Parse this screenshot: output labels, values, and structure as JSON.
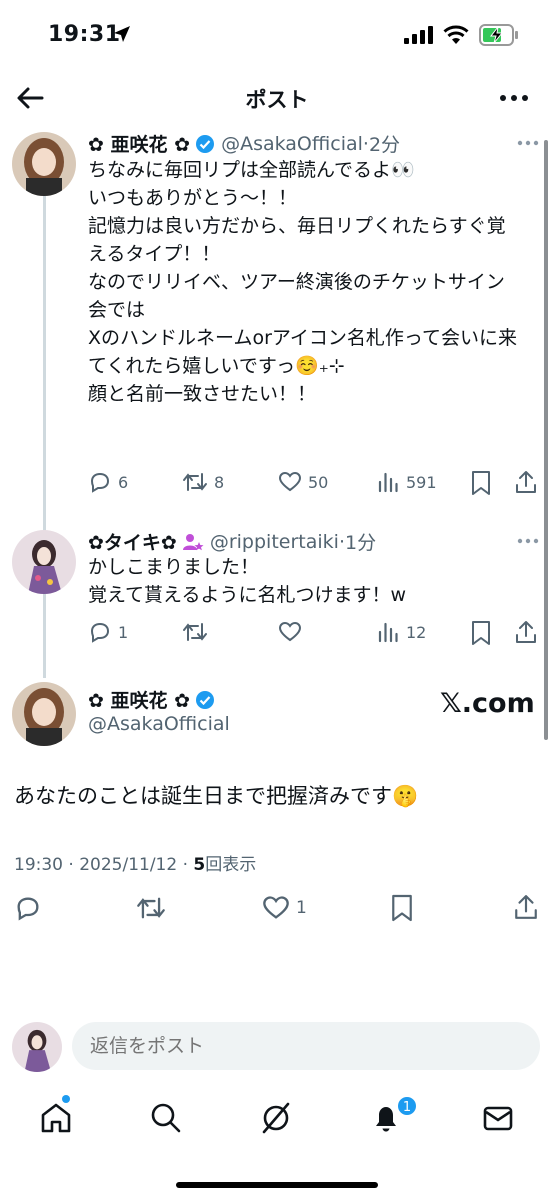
{
  "status_bar": {
    "time": "19:31"
  },
  "nav": {
    "title": "ポスト"
  },
  "thread": [
    {
      "name": "✿ 亜咲花 ✿",
      "handle": "@AsakaOfficial",
      "sep": "·",
      "time": "2分",
      "text_lines": [
        "ちなみに毎回リプは全部読んでるよ👀",
        "いつもありがとう〜！！",
        "",
        "記憶力は良い方だから、毎日リプくれたらすぐ覚",
        "えるタイプ！！",
        "",
        "なのでリリイベ、ツアー終演後のチケットサイン",
        "会では",
        "Xのハンドルネームorアイコン名札作って会いに来",
        "てくれたら嬉しいですっ☺️₊⊹",
        "顔と名前一致させたい！！"
      ],
      "replies": "6",
      "reposts": "8",
      "likes": "50",
      "views": "591"
    },
    {
      "name": "✿タイキ✿",
      "handle": "@rippitertaiki",
      "sep": "·",
      "time": "1分",
      "text_lines": [
        "かしこまりました！",
        "覚えて貰えるように名札つけます！w"
      ],
      "replies": "1",
      "reposts": "",
      "likes": "",
      "views": "12"
    }
  ],
  "main_post": {
    "name": "✿ 亜咲花 ✿",
    "handle": "@AsakaOfficial",
    "watermark": "𝕏.com",
    "text": "あなたのことは誕生日まで把握済みです🤫",
    "meta_prefix": "19:30 · 2025/11/12 · ",
    "view_count": "5",
    "view_label": "回表示",
    "likes": "1"
  },
  "reply_bar": {
    "placeholder": "返信をポスト"
  },
  "tabbar": {
    "notifications_badge": "1"
  },
  "colors": {
    "accent": "#1d9bf0",
    "muted": "#536471",
    "text": "#0f1419"
  },
  "icons": [
    "back-arrow-icon",
    "more-icon",
    "verified-icon",
    "reply-icon",
    "repost-icon",
    "like-icon",
    "views-icon",
    "bookmark-icon",
    "share-icon",
    "home-icon",
    "search-icon",
    "grok-icon",
    "bell-icon",
    "mail-icon"
  ]
}
